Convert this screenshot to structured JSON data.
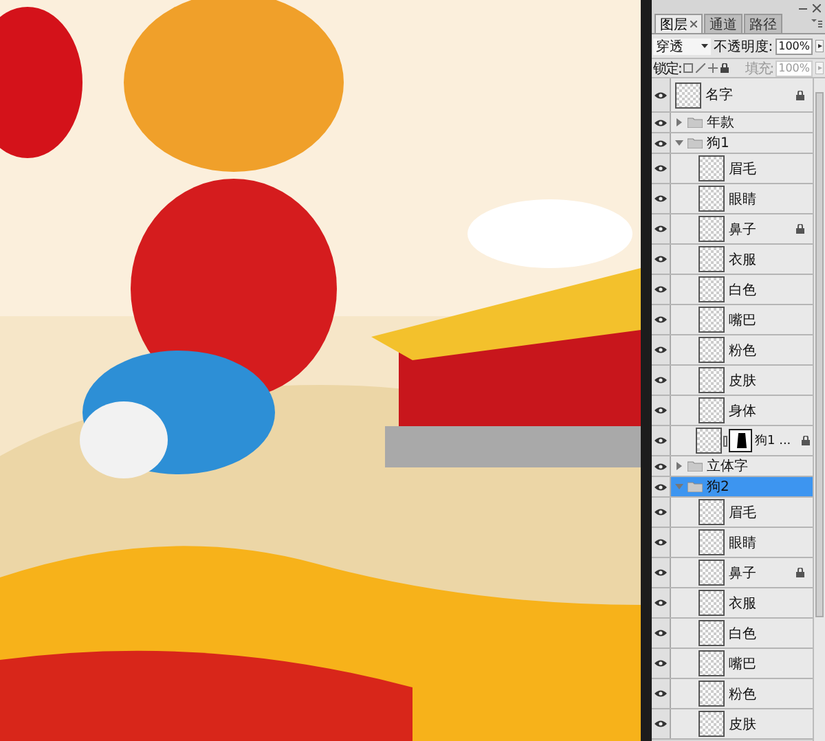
{
  "panel": {
    "tabs": [
      {
        "label": "图层",
        "selected": true,
        "closable": true
      },
      {
        "label": "通道",
        "selected": false,
        "closable": false
      },
      {
        "label": "路径",
        "selected": false,
        "closable": false
      }
    ],
    "blend_mode": "穿透",
    "opacity_label": "不透明度:",
    "opacity": "100%",
    "lock_label": "锁定:",
    "fill_label": "填充:",
    "fill": "100%",
    "fill_disabled": true
  },
  "layers": [
    {
      "kind": "layer",
      "name": "名字",
      "visible": true,
      "locked": true,
      "selected": false
    },
    {
      "kind": "group",
      "name": "年款",
      "visible": true,
      "expanded": false,
      "selected": false
    },
    {
      "kind": "group",
      "name": "狗1",
      "visible": true,
      "expanded": true,
      "selected": false,
      "children": [
        {
          "kind": "layer",
          "name": "眉毛",
          "visible": true,
          "locked": false,
          "selected": false
        },
        {
          "kind": "layer",
          "name": "眼睛",
          "visible": true,
          "locked": false,
          "selected": false
        },
        {
          "kind": "layer",
          "name": "鼻子",
          "visible": true,
          "locked": true,
          "selected": false
        },
        {
          "kind": "layer",
          "name": "衣服",
          "visible": true,
          "locked": false,
          "selected": false
        },
        {
          "kind": "layer",
          "name": "白色",
          "visible": true,
          "locked": false,
          "selected": false
        },
        {
          "kind": "layer",
          "name": "嘴巴",
          "visible": true,
          "locked": false,
          "selected": false
        },
        {
          "kind": "layer",
          "name": "粉色",
          "visible": true,
          "locked": false,
          "selected": false
        },
        {
          "kind": "layer",
          "name": "皮肤",
          "visible": true,
          "locked": false,
          "selected": false
        },
        {
          "kind": "layer",
          "name": "身体",
          "visible": true,
          "locked": false,
          "selected": false
        },
        {
          "kind": "masked",
          "name": "狗1 ...",
          "visible": true,
          "locked": true,
          "selected": false
        }
      ]
    },
    {
      "kind": "group",
      "name": "立体字",
      "visible": true,
      "expanded": false,
      "selected": false
    },
    {
      "kind": "group",
      "name": "狗2",
      "visible": true,
      "expanded": true,
      "selected": true,
      "children": [
        {
          "kind": "layer",
          "name": "眉毛",
          "visible": true,
          "locked": false,
          "selected": false
        },
        {
          "kind": "layer",
          "name": "眼睛",
          "visible": true,
          "locked": false,
          "selected": false
        },
        {
          "kind": "layer",
          "name": "鼻子",
          "visible": true,
          "locked": true,
          "selected": false
        },
        {
          "kind": "layer",
          "name": "衣服",
          "visible": true,
          "locked": false,
          "selected": false
        },
        {
          "kind": "layer",
          "name": "白色",
          "visible": true,
          "locked": false,
          "selected": false
        },
        {
          "kind": "layer",
          "name": "嘴巴",
          "visible": true,
          "locked": false,
          "selected": false
        },
        {
          "kind": "layer",
          "name": "粉色",
          "visible": true,
          "locked": false,
          "selected": false
        },
        {
          "kind": "layer",
          "name": "皮肤",
          "visible": true,
          "locked": false,
          "selected": false
        }
      ]
    }
  ]
}
